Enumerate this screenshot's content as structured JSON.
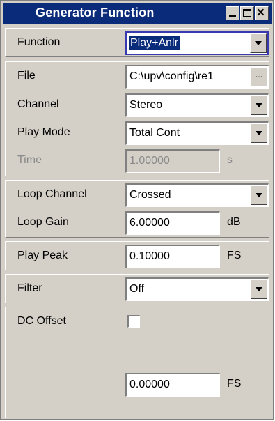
{
  "window": {
    "title": "Generator Function",
    "minimize": "minimize",
    "maximize": "maximize",
    "close": "×"
  },
  "rows": {
    "function": {
      "label": "Function",
      "value": "Play+Anlr"
    },
    "file": {
      "label": "File",
      "value": "C:\\upv\\config\\re1",
      "browse": "..."
    },
    "channel": {
      "label": "Channel",
      "value": "Stereo"
    },
    "play_mode": {
      "label": "Play Mode",
      "value": "Total Cont"
    },
    "time": {
      "label": "Time",
      "value": "1.00000",
      "unit": "s"
    },
    "loop_channel": {
      "label": "Loop Channel",
      "value": "Crossed"
    },
    "loop_gain": {
      "label": "Loop Gain",
      "value": "6.00000",
      "unit": "dB"
    },
    "play_peak": {
      "label": "Play Peak",
      "value": "0.10000",
      "unit": "FS"
    },
    "filter": {
      "label": "Filter",
      "value": "Off"
    },
    "dc_offset": {
      "label": "DC Offset",
      "checked": false,
      "value": "0.00000",
      "unit": "FS"
    }
  },
  "colors": {
    "title_bar": "#0a2a7a",
    "panel": "#d4d0c8",
    "disabled_text": "#8a8a8a"
  }
}
